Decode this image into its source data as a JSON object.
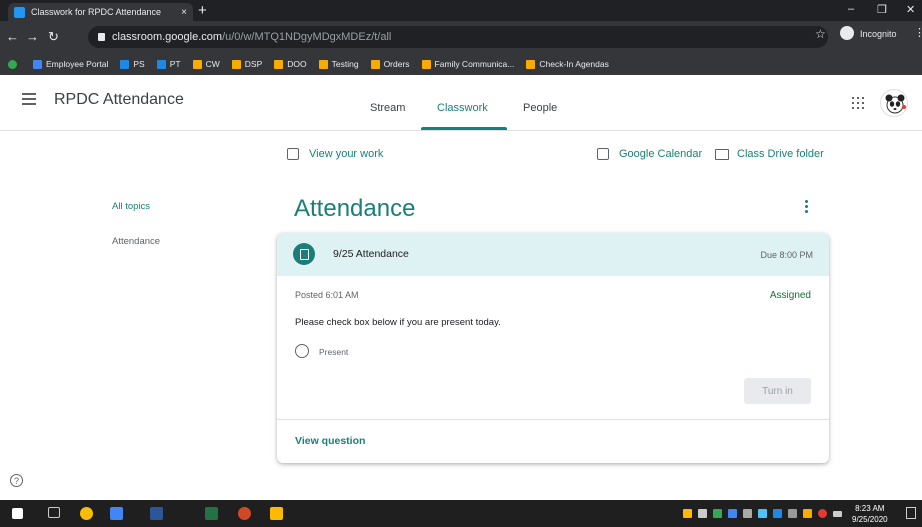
{
  "browser": {
    "tab_title": "Classwork for RPDC Attendance",
    "tab_close": "×",
    "new_tab": "+",
    "url_host": "classroom.google.com",
    "url_path": "/u/0/w/MTQ1NDgyMDgxMDEz/t/all",
    "incognito_label": "Incognito",
    "bookmarks": [
      {
        "label": "Employee Portal",
        "color": "#4285f4"
      },
      {
        "label": "PS",
        "color": "#1e88e5"
      },
      {
        "label": "PT",
        "color": "#1e88e5"
      },
      {
        "label": "CW",
        "color": "#f9ab00"
      },
      {
        "label": "DSP",
        "color": "#f9ab00"
      },
      {
        "label": "DOO",
        "color": "#f9ab00"
      },
      {
        "label": "Testing",
        "color": "#f9ab00"
      },
      {
        "label": "Orders",
        "color": "#f9ab00"
      },
      {
        "label": "Family Communica...",
        "color": "#f9ab00"
      },
      {
        "label": "Check-In Agendas",
        "color": "#f9ab00"
      }
    ]
  },
  "header": {
    "class_name": "RPDC Attendance",
    "tabs": [
      "Stream",
      "Classwork",
      "People"
    ],
    "active_tab": "Classwork"
  },
  "toolbar": {
    "view_work": "View your work",
    "calendar": "Google Calendar",
    "drive": "Class Drive folder"
  },
  "topics": {
    "all": "All topics",
    "items": [
      "Attendance"
    ]
  },
  "main": {
    "heading": "Attendance"
  },
  "assignment": {
    "title": "9/25 Attendance",
    "due": "Due 8:00 PM",
    "posted": "Posted 6:01 AM",
    "status": "Assigned",
    "instructions": "Please check box below if you are present today.",
    "option": "Present",
    "turn_in": "Turn in",
    "view_question": "View question"
  },
  "help": "?",
  "taskbar": {
    "time": "8:23 AM",
    "date": "9/25/2020"
  },
  "colors": {
    "accent": "#1a7f7a",
    "card_header": "#dff2f3"
  }
}
